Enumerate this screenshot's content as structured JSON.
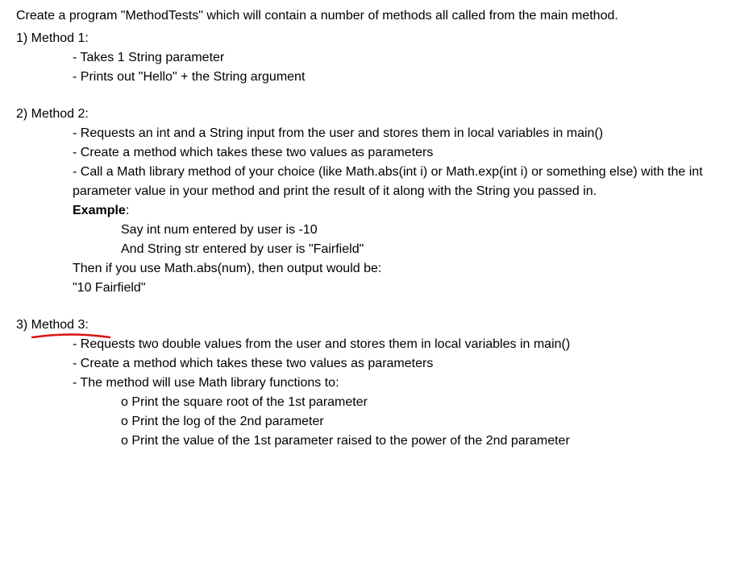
{
  "intro": "Create a program \"MethodTests\" which will contain a number of methods all called from the main method.",
  "m1": {
    "header": "1) Method 1:",
    "l1": "- Takes 1 String parameter",
    "l2": "- Prints out \"Hello\" + the String argument"
  },
  "m2": {
    "header": "2) Method 2:",
    "l1": "- Requests an int and a String input from the user and stores them in local variables in main()",
    "l2": "- Create a method which takes these two values as parameters",
    "l3": "- Call a Math library method of your choice (like Math.abs(int i) or Math.exp(int i) or something else) with the int parameter value in your method and print the result of it along with the String  you passed in.",
    "exampleLabel": "Example",
    "exampleColon": ":",
    "e1": "Say int num entered by user is -10",
    "e2": "And String str entered by user is \"Fairfield\"",
    "e3": "Then if you use Math.abs(num), then output would be:",
    "e4": "\"10 Fairfield\""
  },
  "m3": {
    "header": "3) Method 3:",
    "l1": "- Requests two double values from the user and stores them in local variables in main()",
    "l2": "- Create a method which takes these two values as parameters",
    "l3": "- The method will use Math library functions to:",
    "s1": "o Print the square root of the 1st parameter",
    "s2": "o Print the log of the 2nd parameter",
    "s3": "o Print the value of the 1st parameter raised to the power of the 2nd parameter"
  }
}
